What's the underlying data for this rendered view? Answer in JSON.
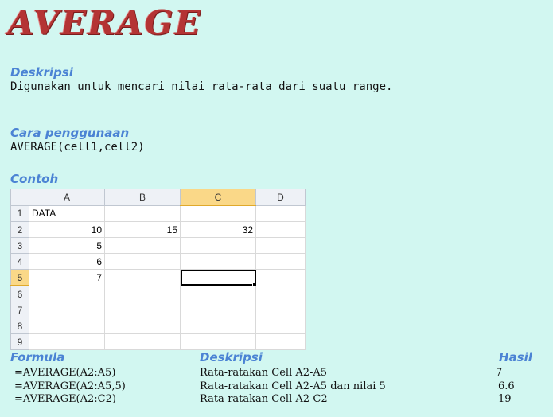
{
  "title": "AVERAGE",
  "deskripsi": {
    "heading": "Deskripsi",
    "text": "Digunakan untuk mencari nilai rata-rata dari suatu range."
  },
  "cara": {
    "heading": "Cara penggunaan",
    "text": "AVERAGE(cell1,cell2)"
  },
  "contoh": {
    "heading": "Contoh"
  },
  "sheet": {
    "columns": [
      "A",
      "B",
      "C",
      "D"
    ],
    "rows": [
      {
        "n": "1",
        "a": "DATA",
        "b": "",
        "c": "",
        "d": ""
      },
      {
        "n": "2",
        "a": "10",
        "b": "15",
        "c": "32",
        "d": ""
      },
      {
        "n": "3",
        "a": "5",
        "b": "",
        "c": "",
        "d": ""
      },
      {
        "n": "4",
        "a": "6",
        "b": "",
        "c": "",
        "d": ""
      },
      {
        "n": "5",
        "a": "7",
        "b": "",
        "c": "",
        "d": ""
      },
      {
        "n": "6",
        "a": "",
        "b": "",
        "c": "",
        "d": ""
      },
      {
        "n": "7",
        "a": "",
        "b": "",
        "c": "",
        "d": ""
      },
      {
        "n": "8",
        "a": "",
        "b": "",
        "c": "",
        "d": ""
      },
      {
        "n": "9",
        "a": "",
        "b": "",
        "c": "",
        "d": ""
      }
    ],
    "selection_color": "#fad888"
  },
  "table": {
    "headers": {
      "formula": "Formula",
      "deskripsi": "Deskripsi",
      "hasil": "Hasil"
    },
    "rows": [
      {
        "formula": "=AVERAGE(A2:A5)",
        "deskripsi": "Rata-ratakan Cell A2-A5",
        "hasil": "7"
      },
      {
        "formula": "=AVERAGE(A2:A5,5)",
        "deskripsi": "Rata-ratakan Cell A2-A5 dan nilai 5",
        "hasil": "6.6"
      },
      {
        "formula": "=AVERAGE(A2:C2)",
        "deskripsi": "Rata-ratakan Cell A2-C2",
        "hasil": "19"
      }
    ]
  },
  "colors": {
    "background": "#d2f7f1",
    "title": "#b43434",
    "heading": "#4b83d4"
  }
}
